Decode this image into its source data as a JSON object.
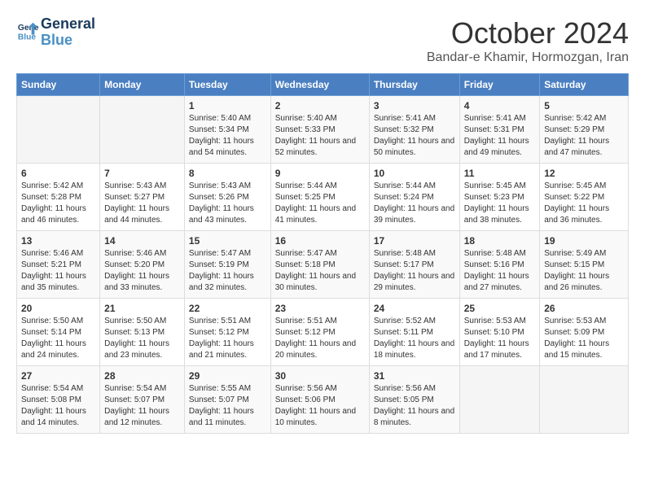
{
  "logo": {
    "line1": "General",
    "line2": "Blue"
  },
  "title": "October 2024",
  "location": "Bandar-e Khamir, Hormozgan, Iran",
  "weekdays": [
    "Sunday",
    "Monday",
    "Tuesday",
    "Wednesday",
    "Thursday",
    "Friday",
    "Saturday"
  ],
  "weeks": [
    [
      {
        "day": "",
        "info": ""
      },
      {
        "day": "",
        "info": ""
      },
      {
        "day": "1",
        "info": "Sunrise: 5:40 AM\nSunset: 5:34 PM\nDaylight: 11 hours and 54 minutes."
      },
      {
        "day": "2",
        "info": "Sunrise: 5:40 AM\nSunset: 5:33 PM\nDaylight: 11 hours and 52 minutes."
      },
      {
        "day": "3",
        "info": "Sunrise: 5:41 AM\nSunset: 5:32 PM\nDaylight: 11 hours and 50 minutes."
      },
      {
        "day": "4",
        "info": "Sunrise: 5:41 AM\nSunset: 5:31 PM\nDaylight: 11 hours and 49 minutes."
      },
      {
        "day": "5",
        "info": "Sunrise: 5:42 AM\nSunset: 5:29 PM\nDaylight: 11 hours and 47 minutes."
      }
    ],
    [
      {
        "day": "6",
        "info": "Sunrise: 5:42 AM\nSunset: 5:28 PM\nDaylight: 11 hours and 46 minutes."
      },
      {
        "day": "7",
        "info": "Sunrise: 5:43 AM\nSunset: 5:27 PM\nDaylight: 11 hours and 44 minutes."
      },
      {
        "day": "8",
        "info": "Sunrise: 5:43 AM\nSunset: 5:26 PM\nDaylight: 11 hours and 43 minutes."
      },
      {
        "day": "9",
        "info": "Sunrise: 5:44 AM\nSunset: 5:25 PM\nDaylight: 11 hours and 41 minutes."
      },
      {
        "day": "10",
        "info": "Sunrise: 5:44 AM\nSunset: 5:24 PM\nDaylight: 11 hours and 39 minutes."
      },
      {
        "day": "11",
        "info": "Sunrise: 5:45 AM\nSunset: 5:23 PM\nDaylight: 11 hours and 38 minutes."
      },
      {
        "day": "12",
        "info": "Sunrise: 5:45 AM\nSunset: 5:22 PM\nDaylight: 11 hours and 36 minutes."
      }
    ],
    [
      {
        "day": "13",
        "info": "Sunrise: 5:46 AM\nSunset: 5:21 PM\nDaylight: 11 hours and 35 minutes."
      },
      {
        "day": "14",
        "info": "Sunrise: 5:46 AM\nSunset: 5:20 PM\nDaylight: 11 hours and 33 minutes."
      },
      {
        "day": "15",
        "info": "Sunrise: 5:47 AM\nSunset: 5:19 PM\nDaylight: 11 hours and 32 minutes."
      },
      {
        "day": "16",
        "info": "Sunrise: 5:47 AM\nSunset: 5:18 PM\nDaylight: 11 hours and 30 minutes."
      },
      {
        "day": "17",
        "info": "Sunrise: 5:48 AM\nSunset: 5:17 PM\nDaylight: 11 hours and 29 minutes."
      },
      {
        "day": "18",
        "info": "Sunrise: 5:48 AM\nSunset: 5:16 PM\nDaylight: 11 hours and 27 minutes."
      },
      {
        "day": "19",
        "info": "Sunrise: 5:49 AM\nSunset: 5:15 PM\nDaylight: 11 hours and 26 minutes."
      }
    ],
    [
      {
        "day": "20",
        "info": "Sunrise: 5:50 AM\nSunset: 5:14 PM\nDaylight: 11 hours and 24 minutes."
      },
      {
        "day": "21",
        "info": "Sunrise: 5:50 AM\nSunset: 5:13 PM\nDaylight: 11 hours and 23 minutes."
      },
      {
        "day": "22",
        "info": "Sunrise: 5:51 AM\nSunset: 5:12 PM\nDaylight: 11 hours and 21 minutes."
      },
      {
        "day": "23",
        "info": "Sunrise: 5:51 AM\nSunset: 5:12 PM\nDaylight: 11 hours and 20 minutes."
      },
      {
        "day": "24",
        "info": "Sunrise: 5:52 AM\nSunset: 5:11 PM\nDaylight: 11 hours and 18 minutes."
      },
      {
        "day": "25",
        "info": "Sunrise: 5:53 AM\nSunset: 5:10 PM\nDaylight: 11 hours and 17 minutes."
      },
      {
        "day": "26",
        "info": "Sunrise: 5:53 AM\nSunset: 5:09 PM\nDaylight: 11 hours and 15 minutes."
      }
    ],
    [
      {
        "day": "27",
        "info": "Sunrise: 5:54 AM\nSunset: 5:08 PM\nDaylight: 11 hours and 14 minutes."
      },
      {
        "day": "28",
        "info": "Sunrise: 5:54 AM\nSunset: 5:07 PM\nDaylight: 11 hours and 12 minutes."
      },
      {
        "day": "29",
        "info": "Sunrise: 5:55 AM\nSunset: 5:07 PM\nDaylight: 11 hours and 11 minutes."
      },
      {
        "day": "30",
        "info": "Sunrise: 5:56 AM\nSunset: 5:06 PM\nDaylight: 11 hours and 10 minutes."
      },
      {
        "day": "31",
        "info": "Sunrise: 5:56 AM\nSunset: 5:05 PM\nDaylight: 11 hours and 8 minutes."
      },
      {
        "day": "",
        "info": ""
      },
      {
        "day": "",
        "info": ""
      }
    ]
  ]
}
